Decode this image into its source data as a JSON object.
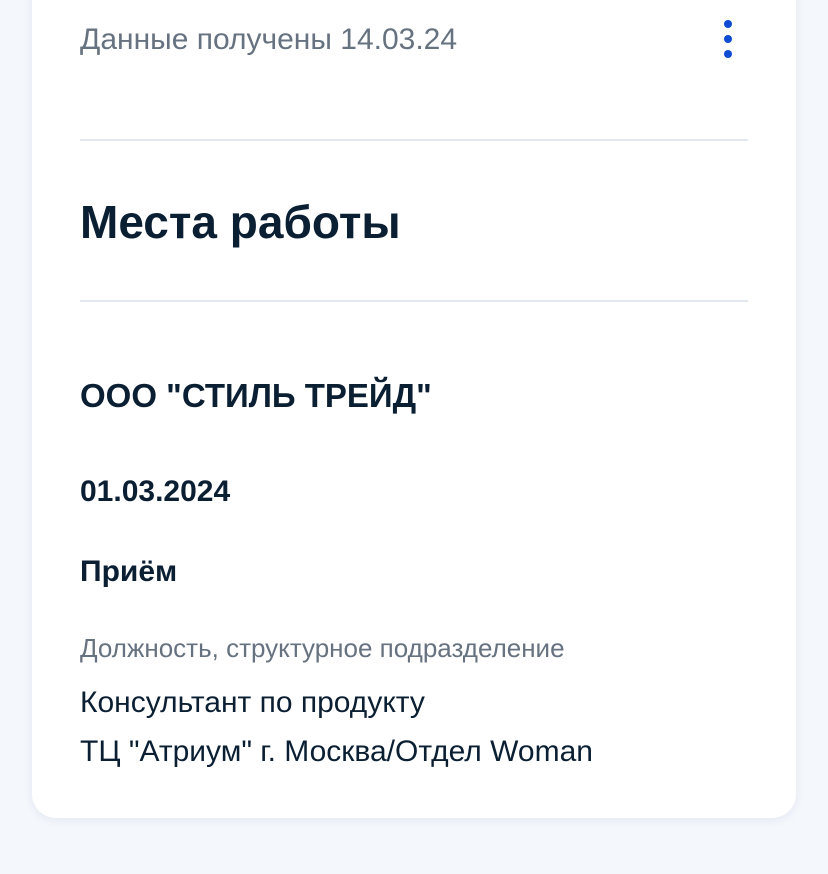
{
  "header": {
    "data_received": "Данные получены 14.03.24",
    "menu_icon": "more-vertical-icon"
  },
  "section": {
    "title": "Места работы"
  },
  "employment": {
    "company": "ООО \"СТИЛЬ ТРЕЙД\"",
    "date": "01.03.2024",
    "event": "Приём",
    "position_label": "Должность, структурное подразделение",
    "position_lines": [
      "Консультант по продукту",
      "ТЦ \"Атриум\" г. Москва/Отдел Woman"
    ]
  },
  "colors": {
    "accent": "#0d4cd3",
    "text_primary": "#0b1f33",
    "text_secondary": "#66727f",
    "divider": "#e3e8ee",
    "background": "#f4f7fc"
  }
}
